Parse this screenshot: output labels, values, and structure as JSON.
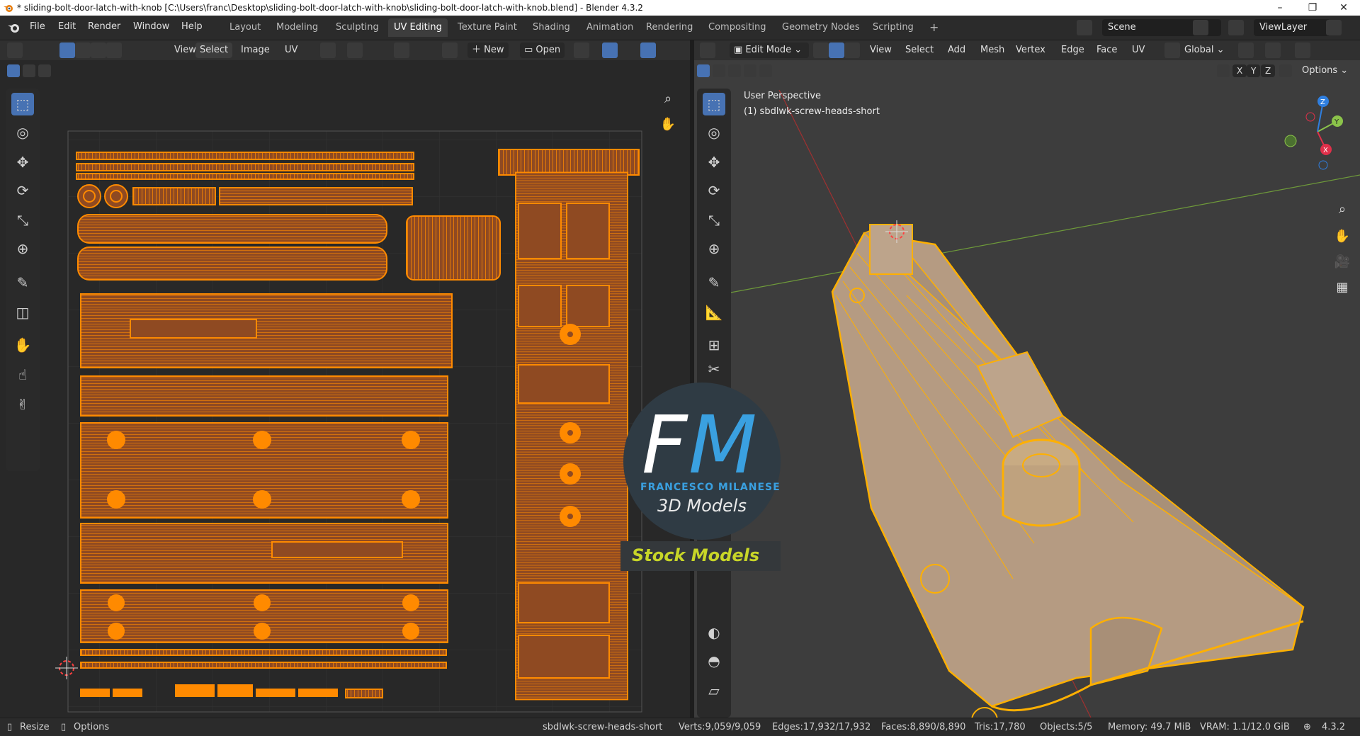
{
  "window": {
    "title": "* sliding-bolt-door-latch-with-knob [C:\\Users\\franc\\Desktop\\sliding-bolt-door-latch-with-knob\\sliding-bolt-door-latch-with-knob.blend] - Blender 4.3.2",
    "controls": [
      "–",
      "❐",
      "✕"
    ]
  },
  "menu": [
    "File",
    "Edit",
    "Render",
    "Window",
    "Help"
  ],
  "workspaces": {
    "tabs": [
      "Layout",
      "Modeling",
      "Sculpting",
      "UV Editing",
      "Texture Paint",
      "Shading",
      "Animation",
      "Rendering",
      "Compositing",
      "Geometry Nodes",
      "Scripting"
    ],
    "active": "UV Editing",
    "add_label": "+"
  },
  "scene": {
    "name": "Scene",
    "view_layer": "ViewLayer"
  },
  "uv_editor": {
    "menus": [
      "View",
      "Select",
      "Image",
      "UV"
    ],
    "new_label": "New",
    "open_label": "Open"
  },
  "viewport": {
    "mode": "Edit Mode",
    "menus": [
      "View",
      "Select",
      "Add",
      "Mesh",
      "Vertex",
      "Edge",
      "Face",
      "UV"
    ],
    "orientation": "Global",
    "axes": [
      "X",
      "Y",
      "Z"
    ],
    "options_label": "Options",
    "perspective_label": "User Perspective",
    "object_label": "(1) sbdlwk-screw-heads-short",
    "gizmo_axes": {
      "x": "X",
      "y": "Y",
      "z": "Z"
    },
    "colors": {
      "x": "#e0304a",
      "y": "#8bc34a",
      "z": "#2f7fe0",
      "mesh_wire": "#ffb000",
      "mesh_face": "#b59b82"
    }
  },
  "watermark": {
    "initials_f": "F",
    "initials_m": "M",
    "name": "FRANCESCO MILANESE",
    "subtitle": "3D Models",
    "banner": "Stock Models",
    "colors": {
      "circle": "#2f3b44",
      "f": "#ffffff",
      "m": "#3aa0e0",
      "banner": "#c8d628"
    }
  },
  "uv_colors": {
    "island_fill": "#8f4a22",
    "island_edge": "#ff8a00"
  },
  "status": {
    "resize": "Resize",
    "options": "Options",
    "object": "sbdlwk-screw-heads-short",
    "verts": "Verts:9,059/9,059",
    "edges": "Edges:17,932/17,932",
    "faces": "Faces:8,890/8,890",
    "tris": "Tris:17,780",
    "objects": "Objects:5/5",
    "memory": "Memory: 49.7 MiB",
    "vram": "VRAM: 1.1/12.0 GiB",
    "version": "4.3.2"
  }
}
